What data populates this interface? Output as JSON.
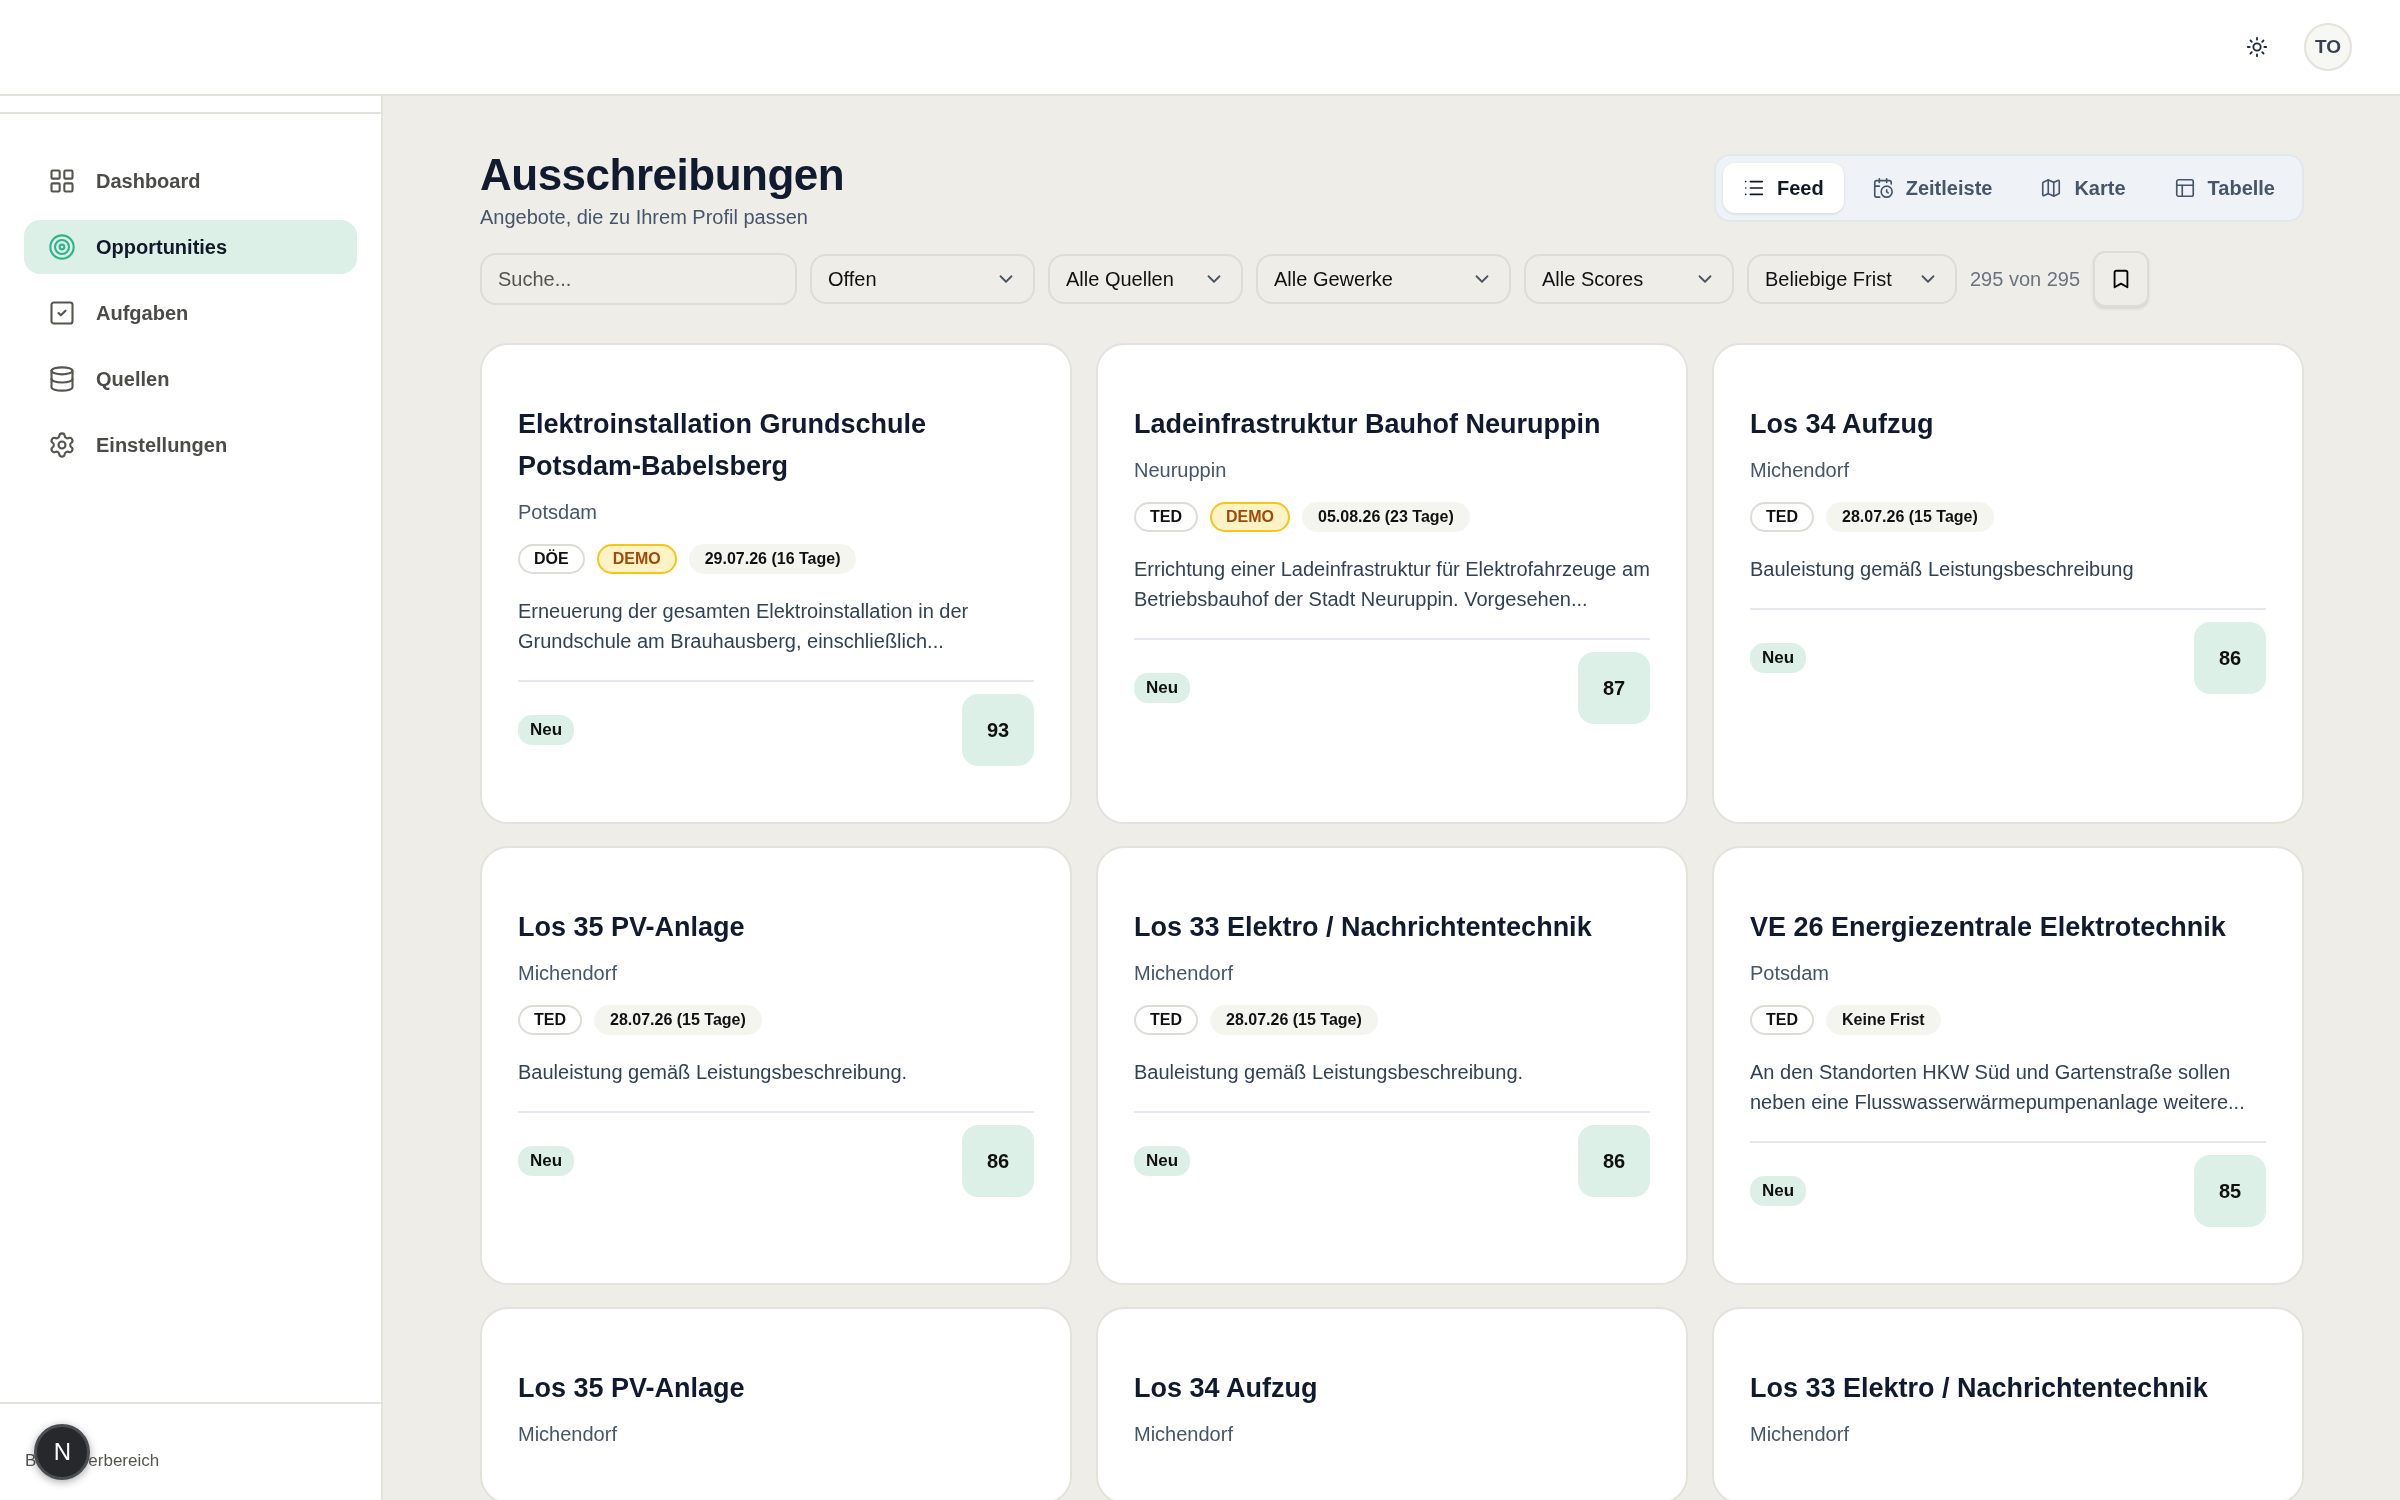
{
  "header": {
    "avatar": "TO"
  },
  "sidebar": {
    "items": [
      {
        "label": "Dashboard",
        "selected": false
      },
      {
        "label": "Opportunities",
        "selected": true
      },
      {
        "label": "Aufgaben",
        "selected": false
      },
      {
        "label": "Quellen",
        "selected": false
      },
      {
        "label": "Einstellungen",
        "selected": false
      }
    ],
    "footer_text_parts": [
      "B",
      "erbereich"
    ],
    "dev_badge": "N"
  },
  "page": {
    "title": "Ausschreibungen",
    "subtitle": "Angebote, die zu Ihrem Profil passen"
  },
  "view_tabs": [
    {
      "label": "Feed",
      "selected": true
    },
    {
      "label": "Zeitleiste",
      "selected": false
    },
    {
      "label": "Karte",
      "selected": false
    },
    {
      "label": "Tabelle",
      "selected": false
    }
  ],
  "filters": {
    "search": {
      "placeholder": "Suche..."
    },
    "dropdowns": [
      "Offen",
      "Alle Quellen",
      "Alle Gewerke",
      "Alle Scores",
      "Beliebige Frist"
    ],
    "count": "295 von 295"
  },
  "cards": [
    {
      "title": "Elektroinstallation Grundschule Potsdam-Babelsberg",
      "location": "Potsdam",
      "tags": [
        {
          "kind": "source",
          "label": "DÖE"
        },
        {
          "kind": "demo",
          "label": "DEMO"
        },
        {
          "kind": "date",
          "label": "29.07.26 (16 Tage)"
        }
      ],
      "description": "Erneuerung der gesamten Elektroinstallation in der Grundschule am Brauhausberg, einschließlich...",
      "status": "Neu",
      "score": "93"
    },
    {
      "title": "Ladeinfrastruktur Bauhof Neuruppin",
      "location": "Neuruppin",
      "tags": [
        {
          "kind": "source",
          "label": "TED"
        },
        {
          "kind": "demo",
          "label": "DEMO"
        },
        {
          "kind": "date",
          "label": "05.08.26 (23 Tage)"
        }
      ],
      "description": "Errichtung einer Ladeinfrastruktur für Elektrofahrzeuge am Betriebsbauhof der Stadt Neuruppin. Vorgesehen...",
      "status": "Neu",
      "score": "87"
    },
    {
      "title": "Los 34 Aufzug",
      "location": "Michendorf",
      "tags": [
        {
          "kind": "source",
          "label": "TED"
        },
        {
          "kind": "date",
          "label": "28.07.26 (15 Tage)"
        }
      ],
      "description": "Bauleistung gemäß Leistungsbeschreibung",
      "status": "Neu",
      "score": "86"
    },
    {
      "title": "Los 35 PV-Anlage",
      "location": "Michendorf",
      "tags": [
        {
          "kind": "source",
          "label": "TED"
        },
        {
          "kind": "date",
          "label": "28.07.26 (15 Tage)"
        }
      ],
      "description": "Bauleistung gemäß Leistungsbeschreibung.",
      "status": "Neu",
      "score": "86"
    },
    {
      "title": "Los 33 Elektro / Nachrichtentechnik",
      "location": "Michendorf",
      "tags": [
        {
          "kind": "source",
          "label": "TED"
        },
        {
          "kind": "date",
          "label": "28.07.26 (15 Tage)"
        }
      ],
      "description": "Bauleistung gemäß Leistungsbeschreibung.",
      "status": "Neu",
      "score": "86"
    },
    {
      "title": "VE 26 Energiezentrale Elektrotechnik",
      "location": "Potsdam",
      "tags": [
        {
          "kind": "source",
          "label": "TED"
        },
        {
          "kind": "date",
          "label": "Keine Frist"
        }
      ],
      "description": "An den Standorten HKW Süd und Gartenstraße sollen neben eine Flusswasserwärmepumpenanlage weitere...",
      "status": "Neu",
      "score": "85"
    },
    {
      "title": "Los 35 PV-Anlage",
      "location": "Michendorf"
    },
    {
      "title": "Los 34 Aufzug",
      "location": "Michendorf"
    },
    {
      "title": "Los 33 Elektro / Nachrichtentechnik",
      "location": "Michendorf"
    }
  ]
}
